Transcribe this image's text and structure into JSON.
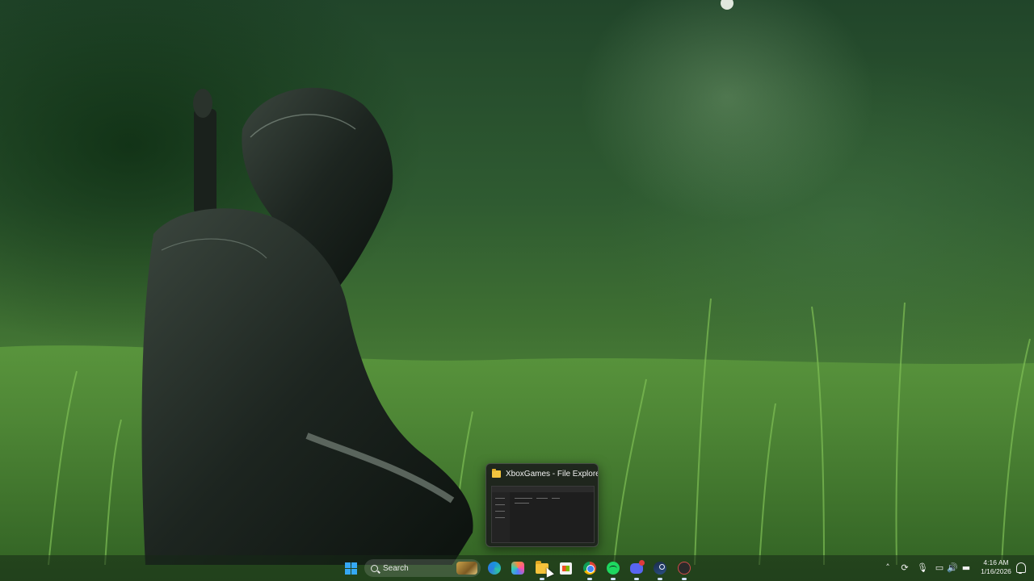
{
  "preview": {
    "title": "XboxGames - File Explorer"
  },
  "taskbar": {
    "search_placeholder": "Search",
    "pinned": [
      {
        "name": "edge-icon"
      },
      {
        "name": "copilot-icon"
      },
      {
        "name": "file-explorer-icon"
      },
      {
        "name": "microsoft-store-icon"
      },
      {
        "name": "chrome-icon"
      },
      {
        "name": "spotify-icon"
      },
      {
        "name": "discord-icon"
      },
      {
        "name": "steam-icon"
      },
      {
        "name": "app-icon"
      }
    ]
  },
  "tray": {
    "time": "4:16 AM",
    "date": "1/16/2026"
  },
  "colors": {
    "accent": "#35a8f4",
    "folder": "#f5c33b"
  }
}
